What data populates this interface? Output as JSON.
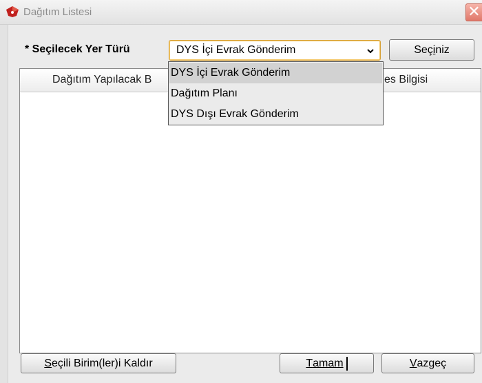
{
  "window": {
    "title": "Dağıtım Listesi",
    "close_symbol": "✕"
  },
  "form": {
    "type_label": "* Seçilecek Yer Türü",
    "select_value": "DYS İçi Evrak Gönderim",
    "select_button_pre": "Seç",
    "select_button_mn": "i",
    "select_button_post": "niz"
  },
  "table": {
    "headers": [
      "Dağıtım Yapılacak B",
      "es Bilgisi"
    ]
  },
  "dropdown": {
    "options": [
      "DYS İçi Evrak Gönderim",
      "Dağıtım Planı",
      "DYS Dışı Evrak Gönderim"
    ],
    "selected_index": 0
  },
  "buttons": {
    "remove_mn": "S",
    "remove_rest": "eçili Birim(ler)i Kaldır",
    "ok_mn": "T",
    "ok_rest": "amam",
    "cancel_mn": "V",
    "cancel_rest": "azgeç"
  },
  "colors": {
    "accent_border": "#d6a035",
    "icon_red": "#c0201e"
  }
}
